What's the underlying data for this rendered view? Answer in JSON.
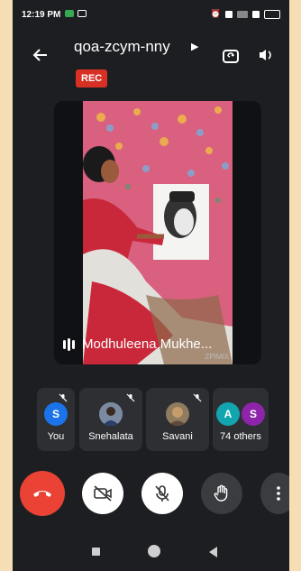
{
  "status_bar": {
    "time": "12:19 PM"
  },
  "header": {
    "meeting_code": "qoa-zcym-nny",
    "recording_badge": "REC",
    "back_icon": "back-arrow-icon",
    "switch_camera_icon": "switch-camera-icon",
    "speaker_icon": "speaker-volume-icon"
  },
  "main_video": {
    "participant_name": "Modhuleena Mukhe...",
    "speaking_indicator_icon": "audio-level-icon",
    "watermark": "ZPIMIX"
  },
  "participants": [
    {
      "label": "You",
      "avatar_letter": "S",
      "avatar_color": "#1a73e8",
      "muted": true
    },
    {
      "label": "Snehalata",
      "avatar_type": "photo",
      "muted": true
    },
    {
      "label": "Savani",
      "avatar_type": "photo",
      "muted": true
    },
    {
      "label": "74 others",
      "avatar_letters": [
        "A",
        "S"
      ],
      "avatar_colors": [
        "#12a4af",
        "#8e24aa"
      ]
    }
  ],
  "controls": {
    "end_call_icon": "end-call-icon",
    "camera_icon": "camera-off-icon",
    "mic_icon": "mic-off-icon",
    "raise_hand_icon": "raise-hand-icon",
    "more_icon": "more-vertical-icon",
    "end_call_color": "#ea4335"
  },
  "colors": {
    "background": "#1d1e21",
    "tile": "#2d2f33",
    "rec": "#d93025"
  }
}
